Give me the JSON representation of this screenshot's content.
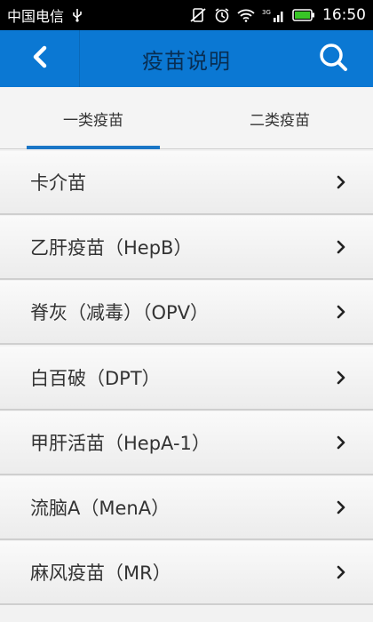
{
  "status_bar": {
    "carrier": "中国电信",
    "time": "16:50",
    "network": "3G"
  },
  "header": {
    "title": "疫苗说明",
    "back_icon": "chevron-left-icon",
    "search_icon": "search-icon"
  },
  "tabs": [
    {
      "label": "一类疫苗",
      "selected": true
    },
    {
      "label": "二类疫苗",
      "selected": false
    }
  ],
  "list": {
    "items": [
      {
        "label": "卡介苗"
      },
      {
        "label": "乙肝疫苗（HepB）"
      },
      {
        "label": "脊灰（减毒）（OPV）"
      },
      {
        "label": "白百破（DPT）"
      },
      {
        "label": "甲肝活苗（HepA-1）"
      },
      {
        "label": "流脑A（MenA）"
      },
      {
        "label": "麻风疫苗（MR）"
      }
    ]
  },
  "colors": {
    "app_bar": "#0b78d3",
    "tab_indicator": "#1a76c6"
  }
}
